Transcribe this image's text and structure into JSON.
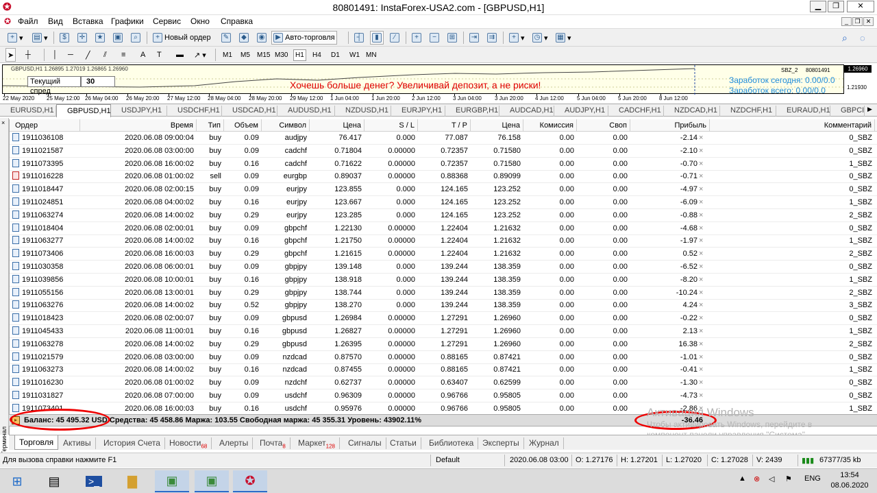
{
  "window": {
    "title": "80801491: InstaForex-USA2.com - [GBPUSD,H1]",
    "menu": [
      "Файл",
      "Вид",
      "Вставка",
      "Графики",
      "Сервис",
      "Окно",
      "Справка"
    ]
  },
  "toolbar": {
    "new_order": "Новый ордер",
    "auto_trading": "Авто-торговля",
    "timeframes": [
      "M1",
      "M5",
      "M15",
      "M30",
      "H1",
      "H4",
      "D1",
      "W1",
      "MN"
    ],
    "selected_timeframe": "H1"
  },
  "chart": {
    "header": "GBPUSD,H1  1.26895 1.27019 1.26865 1.26960",
    "spread_label": "Текущий спред",
    "spread_value": "30",
    "ad_text": "Хочешь больше денег? Увеличивай депозит, а не риски!",
    "earned_today": "Заработок сегодня: 0.00/0.0",
    "earned_total": "Заработок всего: 0.00/0.0",
    "ea_label": "SBZ_2",
    "account_label": "80801491",
    "price_current": "1.26960",
    "price_level": "1.21930",
    "time_labels": [
      "22 May 2020",
      "25 May 12:00",
      "26 May 04:00",
      "26 May 20:00",
      "27 May 12:00",
      "28 May 04:00",
      "28 May 20:00",
      "29 May 12:00",
      "1 Jun 04:00",
      "1 Jun 20:00",
      "2 Jun 12:00",
      "3 Jun 04:00",
      "3 Jun 20:00",
      "4 Jun 12:00",
      "5 Jun 04:00",
      "5 Jun 20:00",
      "8 Jun 12:00"
    ]
  },
  "chart_tabs": [
    "EURUSD,H1",
    "GBPUSD,H1",
    "USDJPY,H1",
    "USDCHF,H1",
    "USDCAD,H1",
    "AUDUSD,H1",
    "NZDUSD,H1",
    "EURJPY,H1",
    "EURGBP,H1",
    "AUDCAD,H1",
    "AUDJPY,H1",
    "CADCHF,H1",
    "NZDCAD,H1",
    "NZDCHF,H1",
    "EURAUD,H1",
    "GBPCI"
  ],
  "active_chart_tab": "GBPUSD,H1",
  "terminal": {
    "side_label": "Терминал",
    "close_glyph": "×",
    "columns": [
      "Ордер",
      "Время",
      "Тип",
      "Объем",
      "Символ",
      "Цена",
      "S / L",
      "T / P",
      "Цена",
      "Комиссия",
      "Своп",
      "Прибыль",
      "Комментарий"
    ],
    "rows": [
      [
        "1911036108",
        "2020.06.08 09:00:04",
        "buy",
        "0.09",
        "audjpy",
        "76.417",
        "0.000",
        "77.087",
        "76.158",
        "0.00",
        "0.00",
        "-2.14",
        "0_SBZ"
      ],
      [
        "1911021587",
        "2020.06.08 03:00:00",
        "buy",
        "0.09",
        "cadchf",
        "0.71804",
        "0.00000",
        "0.72357",
        "0.71580",
        "0.00",
        "0.00",
        "-2.10",
        "0_SBZ"
      ],
      [
        "1911073395",
        "2020.06.08 16:00:02",
        "buy",
        "0.16",
        "cadchf",
        "0.71622",
        "0.00000",
        "0.72357",
        "0.71580",
        "0.00",
        "0.00",
        "-0.70",
        "1_SBZ"
      ],
      [
        "1911016228",
        "2020.06.08 01:00:02",
        "sell",
        "0.09",
        "eurgbp",
        "0.89037",
        "0.00000",
        "0.88368",
        "0.89099",
        "0.00",
        "0.00",
        "-0.71",
        "0_SBZ"
      ],
      [
        "1911018447",
        "2020.06.08 02:00:15",
        "buy",
        "0.09",
        "eurjpy",
        "123.855",
        "0.000",
        "124.165",
        "123.252",
        "0.00",
        "0.00",
        "-4.97",
        "0_SBZ"
      ],
      [
        "1911024851",
        "2020.06.08 04:00:02",
        "buy",
        "0.16",
        "eurjpy",
        "123.667",
        "0.000",
        "124.165",
        "123.252",
        "0.00",
        "0.00",
        "-6.09",
        "1_SBZ"
      ],
      [
        "1911063274",
        "2020.06.08 14:00:02",
        "buy",
        "0.29",
        "eurjpy",
        "123.285",
        "0.000",
        "124.165",
        "123.252",
        "0.00",
        "0.00",
        "-0.88",
        "2_SBZ"
      ],
      [
        "1911018404",
        "2020.06.08 02:00:01",
        "buy",
        "0.09",
        "gbpchf",
        "1.22130",
        "0.00000",
        "1.22404",
        "1.21632",
        "0.00",
        "0.00",
        "-4.68",
        "0_SBZ"
      ],
      [
        "1911063277",
        "2020.06.08 14:00:02",
        "buy",
        "0.16",
        "gbpchf",
        "1.21750",
        "0.00000",
        "1.22404",
        "1.21632",
        "0.00",
        "0.00",
        "-1.97",
        "1_SBZ"
      ],
      [
        "1911073406",
        "2020.06.08 16:00:03",
        "buy",
        "0.29",
        "gbpchf",
        "1.21615",
        "0.00000",
        "1.22404",
        "1.21632",
        "0.00",
        "0.00",
        "0.52",
        "2_SBZ"
      ],
      [
        "1911030358",
        "2020.06.08 06:00:01",
        "buy",
        "0.09",
        "gbpjpy",
        "139.148",
        "0.000",
        "139.244",
        "138.359",
        "0.00",
        "0.00",
        "-6.52",
        "0_SBZ"
      ],
      [
        "1911039856",
        "2020.06.08 10:00:01",
        "buy",
        "0.16",
        "gbpjpy",
        "138.918",
        "0.000",
        "139.244",
        "138.359",
        "0.00",
        "0.00",
        "-8.20",
        "1_SBZ"
      ],
      [
        "1911055156",
        "2020.06.08 13:00:01",
        "buy",
        "0.29",
        "gbpjpy",
        "138.744",
        "0.000",
        "139.244",
        "138.359",
        "0.00",
        "0.00",
        "-10.24",
        "2_SBZ"
      ],
      [
        "1911063276",
        "2020.06.08 14:00:02",
        "buy",
        "0.52",
        "gbpjpy",
        "138.270",
        "0.000",
        "139.244",
        "138.359",
        "0.00",
        "0.00",
        "4.24",
        "3_SBZ"
      ],
      [
        "1911018423",
        "2020.06.08 02:00:07",
        "buy",
        "0.09",
        "gbpusd",
        "1.26984",
        "0.00000",
        "1.27291",
        "1.26960",
        "0.00",
        "0.00",
        "-0.22",
        "0_SBZ"
      ],
      [
        "1911045433",
        "2020.06.08 11:00:01",
        "buy",
        "0.16",
        "gbpusd",
        "1.26827",
        "0.00000",
        "1.27291",
        "1.26960",
        "0.00",
        "0.00",
        "2.13",
        "1_SBZ"
      ],
      [
        "1911063278",
        "2020.06.08 14:00:02",
        "buy",
        "0.29",
        "gbpusd",
        "1.26395",
        "0.00000",
        "1.27291",
        "1.26960",
        "0.00",
        "0.00",
        "16.38",
        "2_SBZ"
      ],
      [
        "1911021579",
        "2020.06.08 03:00:00",
        "buy",
        "0.09",
        "nzdcad",
        "0.87570",
        "0.00000",
        "0.88165",
        "0.87421",
        "0.00",
        "0.00",
        "-1.01",
        "0_SBZ"
      ],
      [
        "1911063273",
        "2020.06.08 14:00:02",
        "buy",
        "0.16",
        "nzdcad",
        "0.87455",
        "0.00000",
        "0.88165",
        "0.87421",
        "0.00",
        "0.00",
        "-0.41",
        "1_SBZ"
      ],
      [
        "1911016230",
        "2020.06.08 01:00:02",
        "buy",
        "0.09",
        "nzdchf",
        "0.62737",
        "0.00000",
        "0.63407",
        "0.62599",
        "0.00",
        "0.00",
        "-1.30",
        "0_SBZ"
      ],
      [
        "1911031827",
        "2020.06.08 07:00:00",
        "buy",
        "0.09",
        "usdchf",
        "0.96309",
        "0.00000",
        "0.96766",
        "0.95805",
        "0.00",
        "0.00",
        "-4.73",
        "0_SBZ"
      ],
      [
        "1911073401",
        "2020.06.08 16:00:03",
        "buy",
        "0.16",
        "usdchf",
        "0.95976",
        "0.00000",
        "0.96766",
        "0.95805",
        "0.00",
        "0.00",
        "-2.86",
        "1_SBZ"
      ]
    ],
    "totals": {
      "text": "Баланс: 45 495.32 USD  Средства: 45 458.86  Маржа: 103.55  Свободная маржа: 45 355.31  Уровень: 43902.11%",
      "profit": "-36.46"
    },
    "tabs": [
      {
        "label": "Торговля",
        "badge": ""
      },
      {
        "label": "Активы",
        "badge": ""
      },
      {
        "label": "История Счета",
        "badge": ""
      },
      {
        "label": "Новости",
        "badge": "68"
      },
      {
        "label": "Алерты",
        "badge": ""
      },
      {
        "label": "Почта",
        "badge": "8"
      },
      {
        "label": "Маркет",
        "badge": "128"
      },
      {
        "label": "Сигналы",
        "badge": ""
      },
      {
        "label": "Статьи",
        "badge": ""
      },
      {
        "label": "Библиотека",
        "badge": ""
      },
      {
        "label": "Эксперты",
        "badge": ""
      },
      {
        "label": "Журнал",
        "badge": ""
      }
    ]
  },
  "statusbar": {
    "help": "Для вызова справки нажмите F1",
    "profile": "Default",
    "datetime": "2020.06.08 03:00",
    "open": "O: 1.27176",
    "high": "H: 1.27201",
    "low": "L: 1.27020",
    "close": "C: 1.27028",
    "volume": "V: 2439",
    "traffic": "67377/35 kb"
  },
  "watermark": {
    "line1": "Активация Windows",
    "line2": "Чтобы активировать Windows, перейдите в",
    "line3": "компонент панели управления \"Система\"."
  },
  "taskbar": {
    "lang": "ENG",
    "time": "13:54",
    "date": "08.06.2020"
  },
  "colors": {
    "accent_blue": "#1e8bd9",
    "ad_red": "#e00000",
    "annotation_red": "#e00000",
    "brand_red": "#c8102e"
  }
}
